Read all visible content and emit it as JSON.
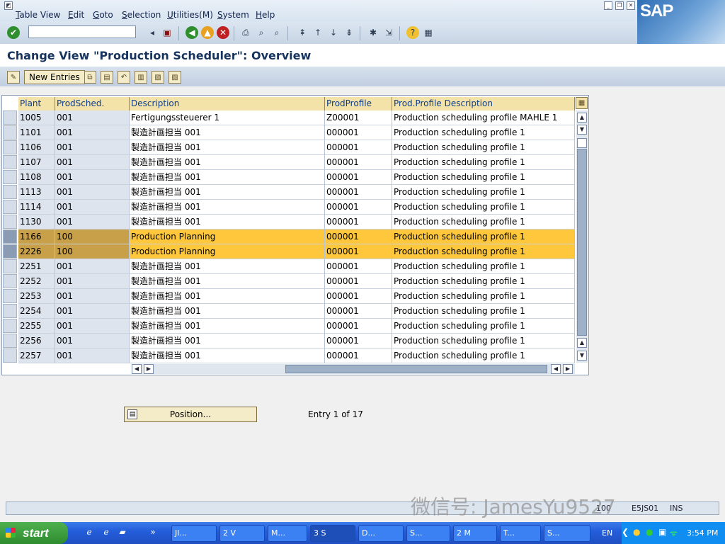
{
  "menu": [
    "Table View",
    "Edit",
    "Goto",
    "Selection",
    "Utilities(M)",
    "System",
    "Help"
  ],
  "logo": "SAP",
  "title": "Change View \"Production Scheduler\": Overview",
  "app_toolbar": {
    "new_entries": "New Entries"
  },
  "table": {
    "headers": [
      "Plant",
      "ProdSched.",
      "Description",
      "ProdProfile",
      "Prod.Profile Description"
    ],
    "rows": [
      [
        "1005",
        "001",
        "Fertigungssteuerer 1",
        "Z00001",
        "Production scheduling profile  MAHLE 1"
      ],
      [
        "1101",
        "001",
        "製造計画担当 001",
        "000001",
        "Production scheduling profile 1"
      ],
      [
        "1106",
        "001",
        "製造計画担当 001",
        "000001",
        "Production scheduling profile 1"
      ],
      [
        "1107",
        "001",
        "製造計画担当 001",
        "000001",
        "Production scheduling profile 1"
      ],
      [
        "1108",
        "001",
        "製造計画担当 001",
        "000001",
        "Production scheduling profile 1"
      ],
      [
        "1113",
        "001",
        "製造計画担当 001",
        "000001",
        "Production scheduling profile 1"
      ],
      [
        "1114",
        "001",
        "製造計画担当 001",
        "000001",
        "Production scheduling profile 1"
      ],
      [
        "1130",
        "001",
        "製造計画担当 001",
        "000001",
        "Production scheduling profile 1"
      ],
      [
        "1166",
        "100",
        "Production Planning",
        "000001",
        "Production scheduling profile 1"
      ],
      [
        "2226",
        "100",
        "Production Planning",
        "000001",
        "Production scheduling profile 1"
      ],
      [
        "2251",
        "001",
        "製造計画担当 001",
        "000001",
        "Production scheduling profile 1"
      ],
      [
        "2252",
        "001",
        "製造計画担当 001",
        "000001",
        "Production scheduling profile 1"
      ],
      [
        "2253",
        "001",
        "製造計画担当 001",
        "000001",
        "Production scheduling profile 1"
      ],
      [
        "2254",
        "001",
        "製造計画担当 001",
        "000001",
        "Production scheduling profile 1"
      ],
      [
        "2255",
        "001",
        "製造計画担当 001",
        "000001",
        "Production scheduling profile 1"
      ],
      [
        "2256",
        "001",
        "製造計画担当 001",
        "000001",
        "Production scheduling profile 1"
      ],
      [
        "2257",
        "001",
        "製造計画担当 001",
        "000001",
        "Production scheduling profile 1"
      ]
    ],
    "selected_rows": [
      8,
      9
    ]
  },
  "position_button": "Position...",
  "entry_info": "Entry 1 of 17",
  "status": {
    "segments": [
      "100",
      "E5JS01",
      "INS"
    ]
  },
  "watermark": "微信号: JamesYu9527",
  "taskbar": {
    "start": "start",
    "tasks": [
      "JI...",
      "2 V",
      "M...",
      "3 S",
      "D...",
      "S...",
      "2 M",
      "T...",
      "S..."
    ],
    "lang": "EN",
    "clock": "3:54 PM"
  },
  "colors": {
    "accent": "#16345E",
    "selected_row": "#FFC83C",
    "header": "#F4E3A9",
    "taskbar": "#245EDB"
  }
}
